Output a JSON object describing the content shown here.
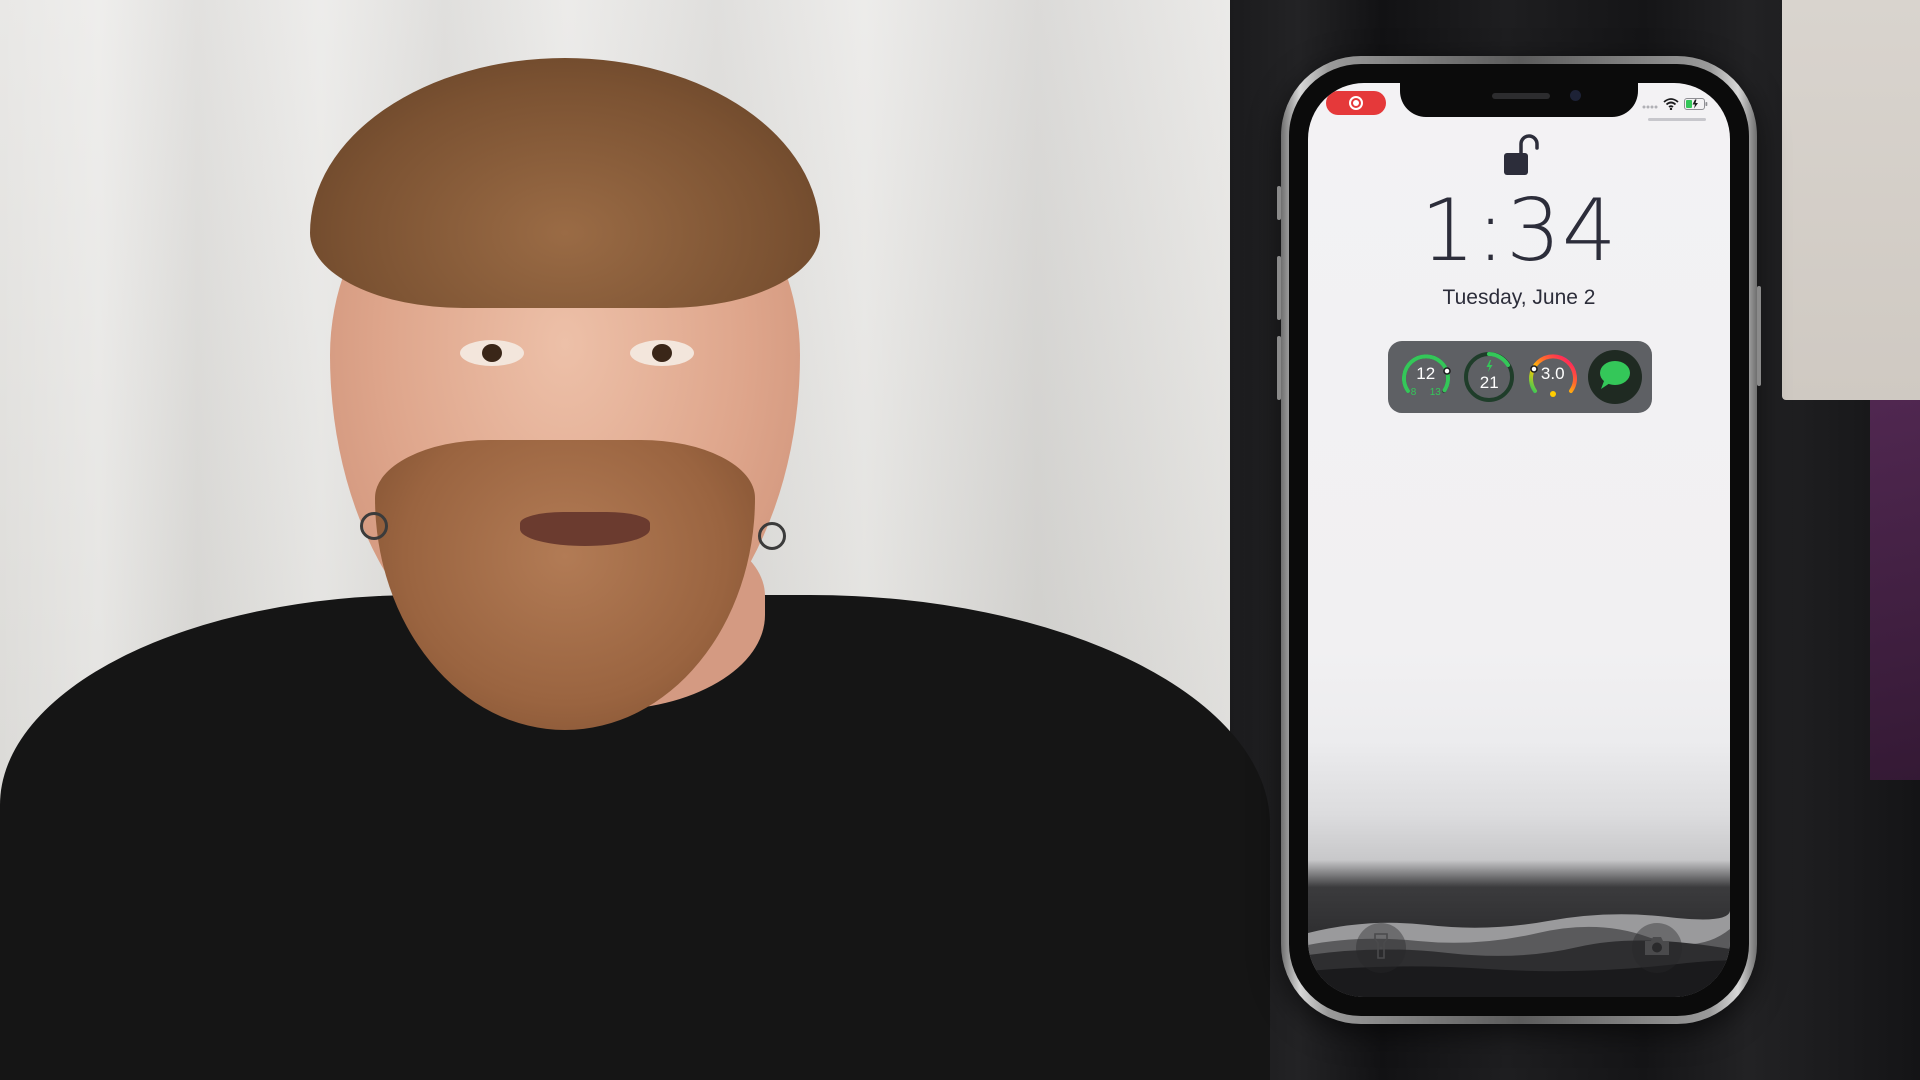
{
  "lock_screen": {
    "time": "1:34",
    "date": "Tuesday, June 2",
    "status": {
      "recording_indicator_color": "#e5393a",
      "wifi_icon": "wifi-icon",
      "battery_icon": "battery-charging-icon"
    },
    "widgets": {
      "temperature": {
        "value": "12",
        "low": "8",
        "high": "13"
      },
      "charge": {
        "value": "21"
      },
      "uv": {
        "value": "3.0"
      },
      "messages_icon": "messages-icon"
    },
    "bottom_controls": {
      "flashlight_icon": "flashlight-icon",
      "camera_icon": "camera-icon"
    }
  },
  "colors": {
    "accent_green": "#34c759",
    "widget_bg": "#5e6064",
    "text_dark": "#2c2d3a"
  }
}
